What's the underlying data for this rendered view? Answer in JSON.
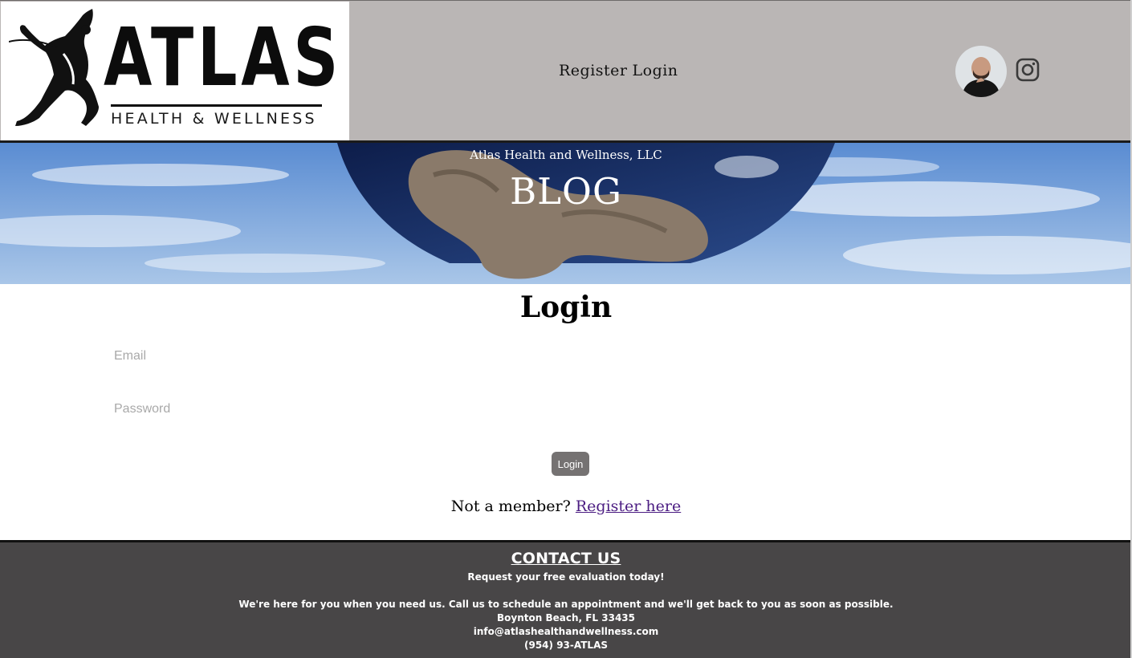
{
  "header": {
    "logo": {
      "word": "ATLAS",
      "subtitle": "HEALTH & WELLNESS"
    },
    "nav": {
      "register_label": "Register",
      "login_label": "Login"
    },
    "social": {
      "avatar_icon": "profile-photo",
      "instagram_icon": "instagram-icon"
    }
  },
  "hero": {
    "subtitle": "Atlas Health and Wellness, LLC",
    "title": "BLOG"
  },
  "login_form": {
    "title": "Login",
    "email_placeholder": "Email",
    "password_placeholder": "Password",
    "submit_label": "Login",
    "member_prompt": "Not a member?",
    "register_link": "Register here"
  },
  "footer": {
    "title": "CONTACT US",
    "tagline": "Request your free evaluation today!",
    "message": "We're here for you when you need us. Call us to schedule an appointment and we'll get back to you as soon as possible.",
    "address": "Boynton Beach, FL 33435",
    "email": "info@atlashealthandwellness.com",
    "phone": "(954) 93-ATLAS"
  },
  "colors": {
    "header_bg": "#bab6b5",
    "footer_bg": "#484647",
    "button_bg": "#757272",
    "link": "#4b1c82",
    "sky": "#4d80c8"
  }
}
